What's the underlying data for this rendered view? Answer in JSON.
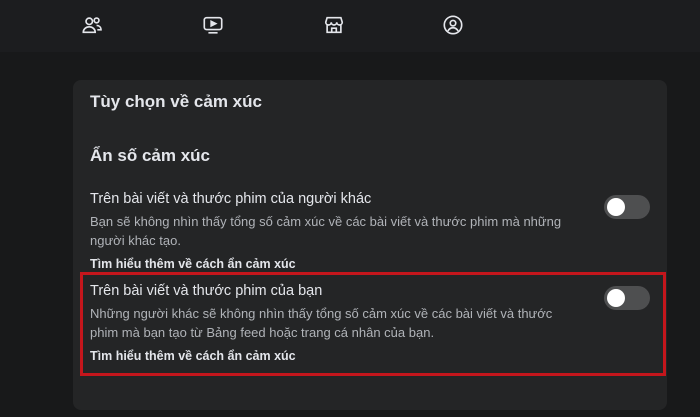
{
  "nav": {
    "items": [
      {
        "icon": "friends-icon"
      },
      {
        "icon": "video-icon"
      },
      {
        "icon": "marketplace-icon"
      },
      {
        "icon": "groups-icon"
      }
    ]
  },
  "panel": {
    "title": "Tùy chọn về cảm xúc",
    "section_title": "Ẩn số cảm xúc",
    "options": [
      {
        "title": "Trên bài viết và thước phim của người khác",
        "description": "Bạn sẽ không nhìn thấy tổng số cảm xúc về các bài viết và thước phim mà những người khác tạo.",
        "link": "Tìm hiểu thêm về cách ẩn cảm xúc",
        "toggle_on": false
      },
      {
        "title": "Trên bài viết và thước phim của bạn",
        "description": "Những người khác sẽ không nhìn thấy tổng số cảm xúc về các bài viết và thước phim mà bạn tạo từ Bảng feed hoặc trang cá nhân của bạn.",
        "link": "Tìm hiểu thêm về cách ẩn cảm xúc",
        "toggle_on": false
      }
    ]
  },
  "colors": {
    "background": "#18191a",
    "panel": "#242526",
    "highlight_border": "#c4161c",
    "toggle_off": "#4e4f50"
  }
}
